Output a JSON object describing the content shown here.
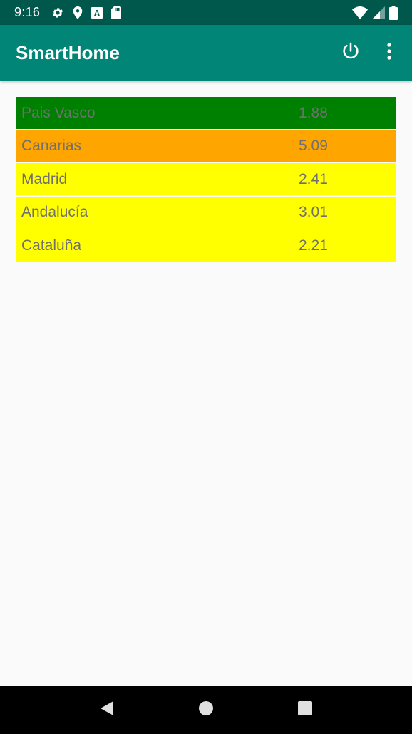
{
  "status_bar": {
    "time": "9:16",
    "left_icons": [
      "settings-icon",
      "location-icon",
      "font-icon",
      "sd-card-icon"
    ],
    "right_icons": [
      "wifi-icon",
      "signal-icon",
      "battery-icon"
    ]
  },
  "app_bar": {
    "title": "SmartHome",
    "actions": [
      "power-icon",
      "overflow-menu-icon"
    ]
  },
  "regions": [
    {
      "name": "Pais Vasco",
      "value": "1.88",
      "color": "#008000"
    },
    {
      "name": "Canarias",
      "value": "5.09",
      "color": "#ffa500"
    },
    {
      "name": "Madrid",
      "value": "2.41",
      "color": "#ffff00"
    },
    {
      "name": "Andalucía",
      "value": "3.01",
      "color": "#ffff00"
    },
    {
      "name": "Cataluña",
      "value": "2.21",
      "color": "#ffff00"
    }
  ],
  "nav_bar": {
    "buttons": [
      "back-icon",
      "home-icon",
      "recents-icon"
    ]
  },
  "colors": {
    "status_bar": "#00574b",
    "app_bar": "#008577",
    "background": "#fafafa",
    "row_text": "#707070"
  }
}
